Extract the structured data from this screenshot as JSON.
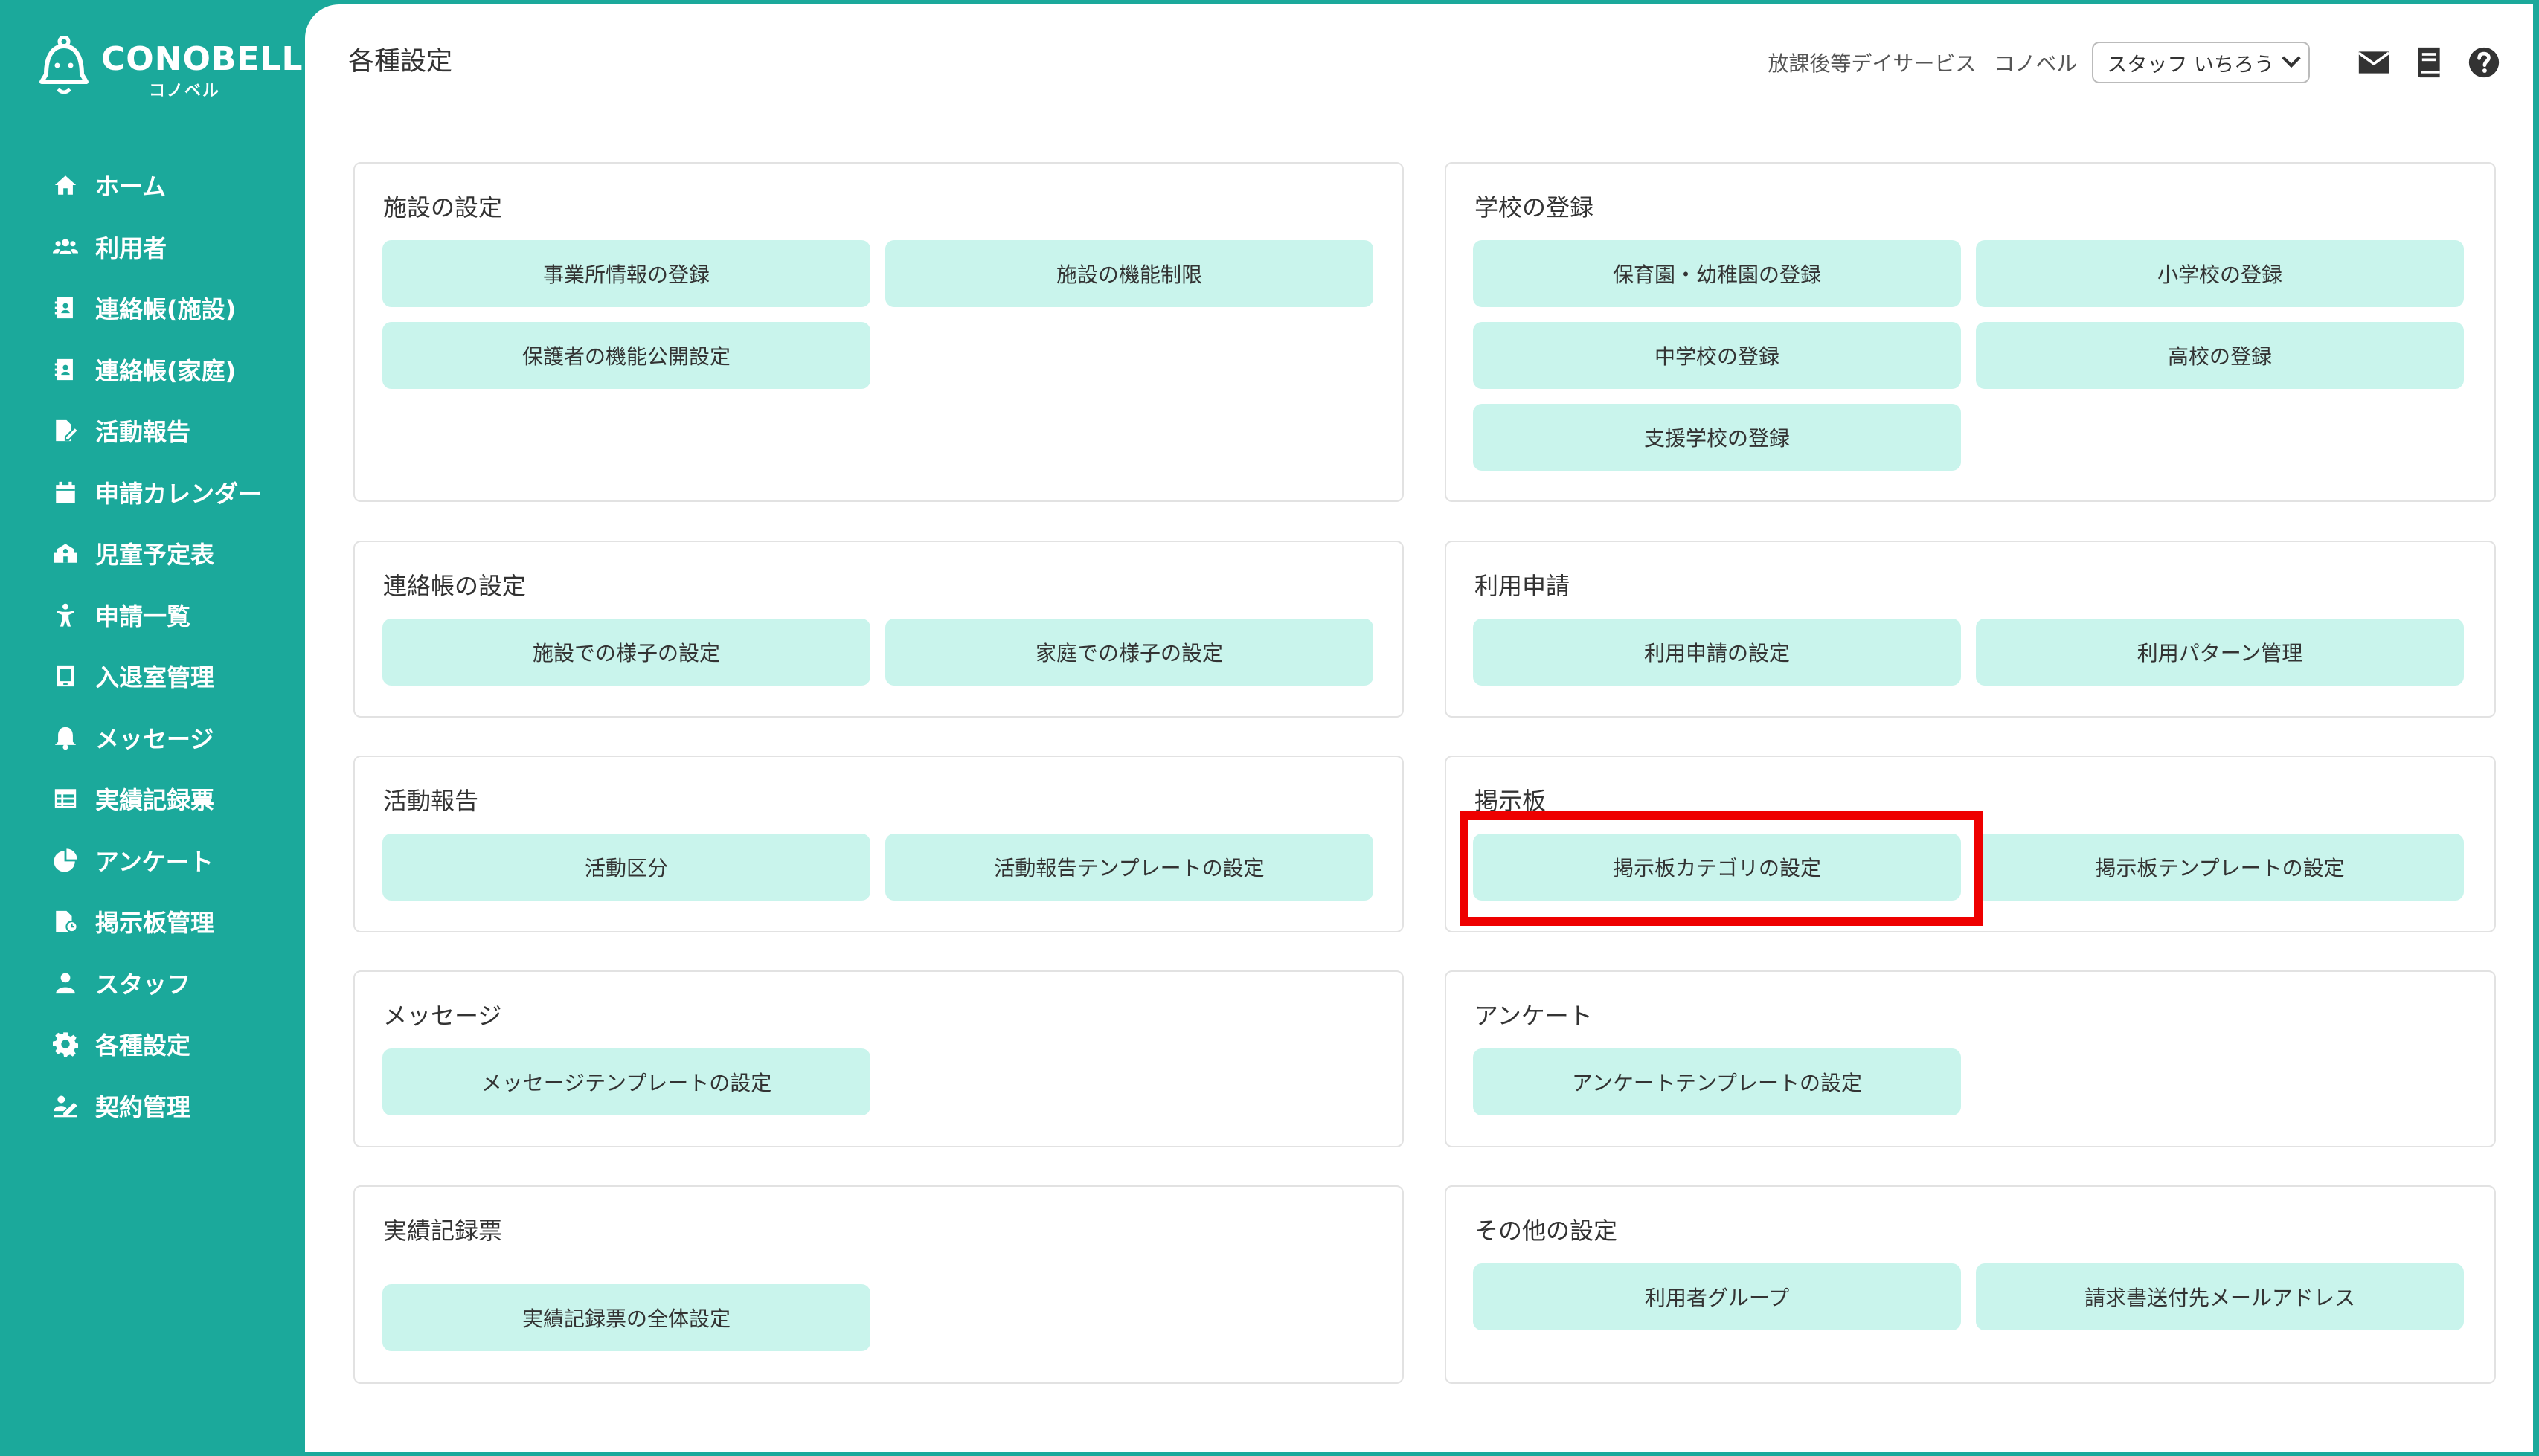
{
  "app": {
    "logo_text": "CONOBELL",
    "logo_sub": "コノベル"
  },
  "sidebar": {
    "items": [
      {
        "label": "ホーム",
        "icon": "home-icon"
      },
      {
        "label": "利用者",
        "icon": "users-icon"
      },
      {
        "label": "連絡帳(施設)",
        "icon": "contact-book-icon"
      },
      {
        "label": "連絡帳(家庭)",
        "icon": "contact-book-icon"
      },
      {
        "label": "活動報告",
        "icon": "report-edit-icon"
      },
      {
        "label": "申請カレンダー",
        "icon": "calendar-icon"
      },
      {
        "label": "児童予定表",
        "icon": "school-icon"
      },
      {
        "label": "申請一覧",
        "icon": "child-icon"
      },
      {
        "label": "入退室管理",
        "icon": "tablet-icon"
      },
      {
        "label": "メッセージ",
        "icon": "bell-icon"
      },
      {
        "label": "実績記録票",
        "icon": "table-icon"
      },
      {
        "label": "アンケート",
        "icon": "pie-chart-icon"
      },
      {
        "label": "掲示板管理",
        "icon": "bulletin-file-icon"
      },
      {
        "label": "スタッフ",
        "icon": "staff-icon"
      },
      {
        "label": "各種設定",
        "icon": "gear-icon"
      },
      {
        "label": "契約管理",
        "icon": "contract-icon"
      }
    ]
  },
  "header": {
    "title": "各種設定",
    "facility": "放課後等デイサービス",
    "company": "コノベル",
    "user": "スタッフ いちろう"
  },
  "sections": [
    {
      "title": "施設の設定",
      "buttons": [
        "事業所情報の登録",
        "施設の機能制限",
        "保護者の機能公開設定"
      ]
    },
    {
      "title": "学校の登録",
      "buttons": [
        "保育園・幼稚園の登録",
        "小学校の登録",
        "中学校の登録",
        "高校の登録",
        "支援学校の登録"
      ]
    },
    {
      "title": "連絡帳の設定",
      "buttons": [
        "施設での様子の設定",
        "家庭での様子の設定"
      ]
    },
    {
      "title": "利用申請",
      "buttons": [
        "利用申請の設定",
        "利用パターン管理"
      ]
    },
    {
      "title": "活動報告",
      "buttons": [
        "活動区分",
        "活動報告テンプレートの設定"
      ]
    },
    {
      "title": "掲示板",
      "buttons": [
        "掲示板カテゴリの設定",
        "掲示板テンプレートの設定"
      ]
    },
    {
      "title": "メッセージ",
      "buttons": [
        "メッセージテンプレートの設定"
      ]
    },
    {
      "title": "アンケート",
      "buttons": [
        "アンケートテンプレートの設定"
      ]
    },
    {
      "title": "実績記録票",
      "buttons": [
        "実績記録票の全体設定"
      ]
    },
    {
      "title": "その他の設定",
      "buttons": [
        "利用者グループ",
        "請求書送付先メールアドレス"
      ]
    }
  ],
  "colors": {
    "brand": "#1ba99b",
    "button_bg": "#c9f4ec",
    "highlight": "#ee0000"
  }
}
